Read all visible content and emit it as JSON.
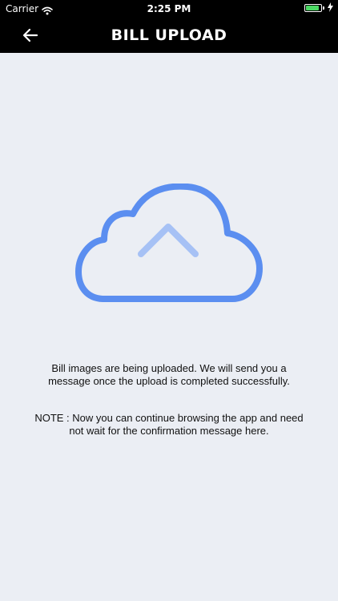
{
  "status_bar": {
    "carrier": "Carrier",
    "time": "2:25 PM",
    "battery_level": 0.85,
    "battery_color": "#4cd964",
    "charging_icon": "bolt-icon"
  },
  "header": {
    "title": "BILL UPLOAD",
    "back_icon": "arrow-left-icon",
    "background": "#000000"
  },
  "illustration": {
    "icon": "cloud-upload-icon",
    "cloud_color": "#5b8ef0",
    "arrow_color": "#a6c1f5"
  },
  "content": {
    "message": "Bill images are being uploaded. We will send you a message once the upload is completed successfully.",
    "note": "NOTE : Now you can continue browsing the app and need not wait for the confirmation message here."
  },
  "colors": {
    "page_background": "#ebeef4"
  }
}
